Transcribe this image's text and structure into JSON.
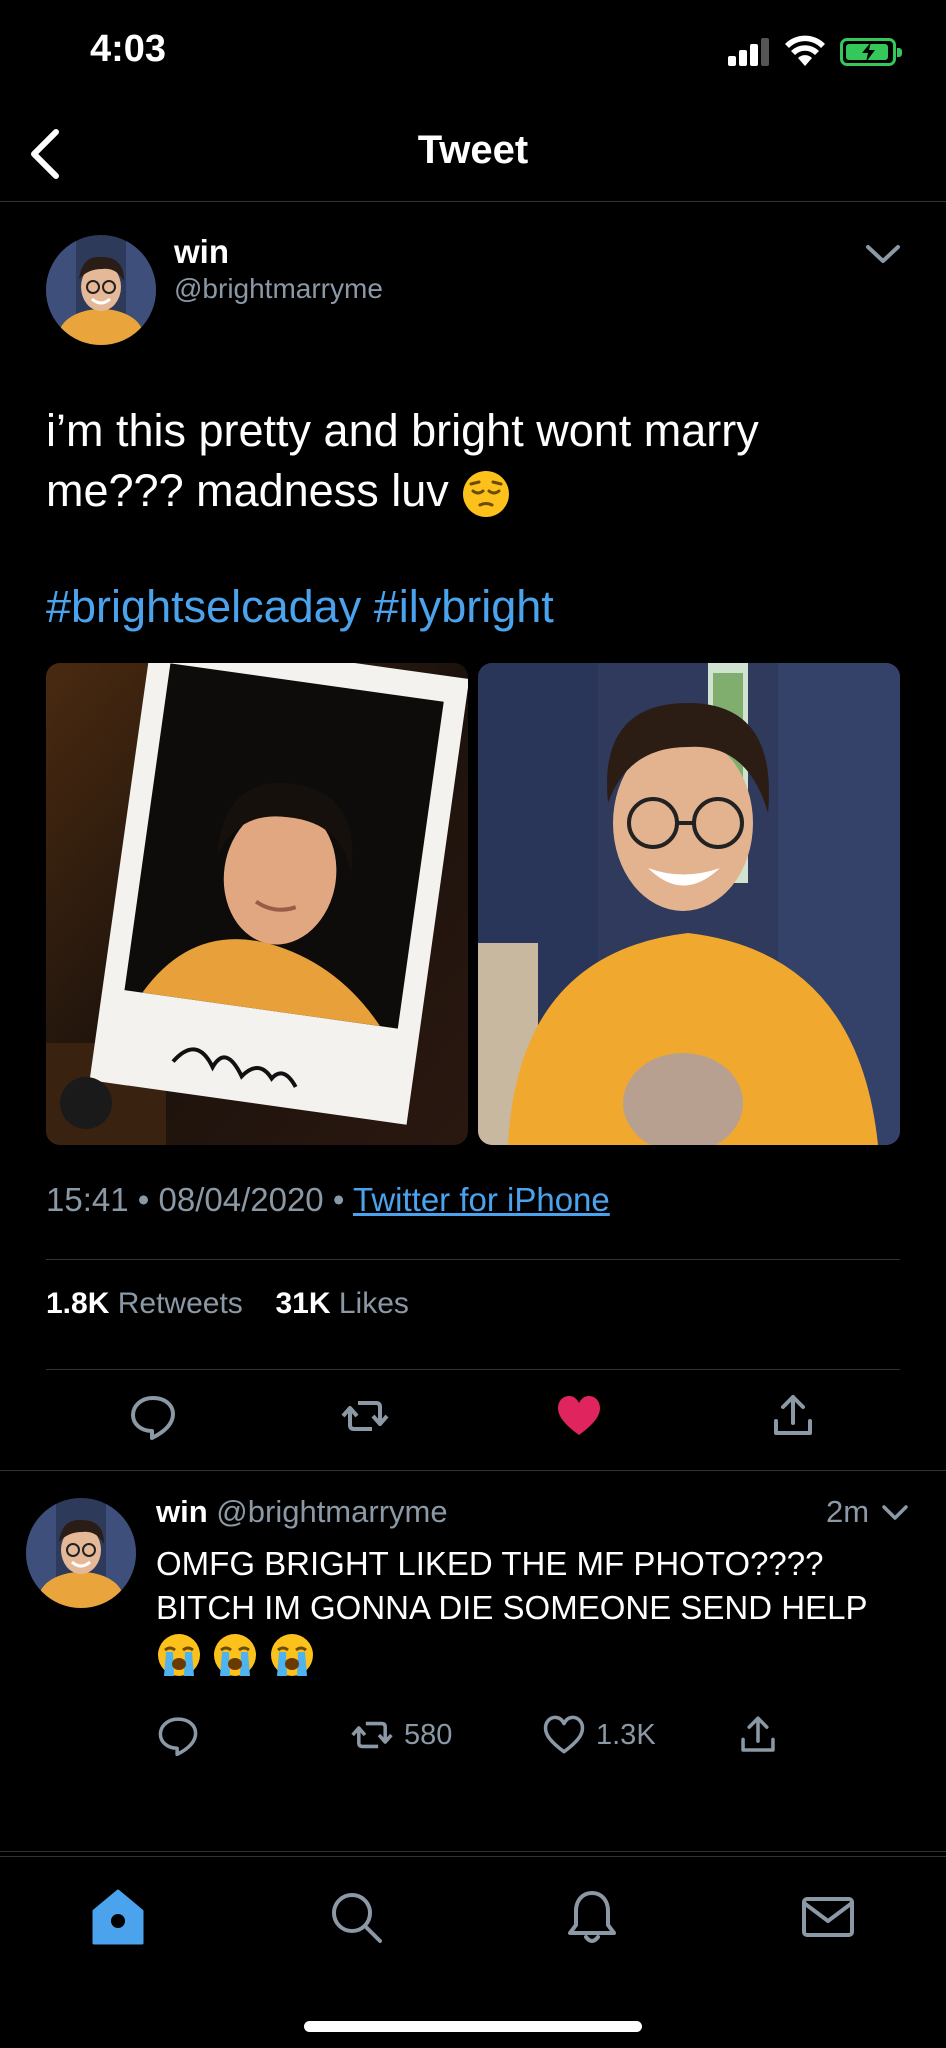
{
  "status_bar": {
    "time": "4:03"
  },
  "nav": {
    "title": "Tweet"
  },
  "tweet": {
    "author_name": "win",
    "author_handle": "@brightmarryme",
    "text": "i’m this pretty and bright wont marry me??? madness luv",
    "text_emoji": "pensive-face",
    "hashtags": [
      "#brightselcaday",
      "#ilybright"
    ],
    "time": "15:41",
    "date": "08/04/2020",
    "separator": "•",
    "source": "Twitter for iPhone",
    "retweets_count": "1.8K",
    "retweets_label": "Retweets",
    "likes_count": "31K",
    "likes_label": "Likes",
    "photos": [
      {
        "icon": "polaroid-photo",
        "signature": "Bright"
      },
      {
        "icon": "selfie-photo"
      }
    ],
    "liked": true
  },
  "reply": {
    "author_name": "win",
    "author_handle": "@brightmarryme",
    "time": "2m",
    "text": "OMFG BRIGHT LIKED THE MF PHOTO???? BITCH IM GONNA DIE SOMEONE SEND HELP",
    "emojis": [
      "loudly-crying-face",
      "loudly-crying-face",
      "loudly-crying-face"
    ],
    "retweets": "580",
    "likes": "1.3K"
  },
  "colors": {
    "background": "#000000",
    "link": "#4aa3ec",
    "muted": "#8b98a5",
    "like": "#e0245e",
    "divider": "#2f3336",
    "active_tab": "#4aa3ec"
  },
  "tabs": [
    "home",
    "search",
    "notifications",
    "messages"
  ]
}
